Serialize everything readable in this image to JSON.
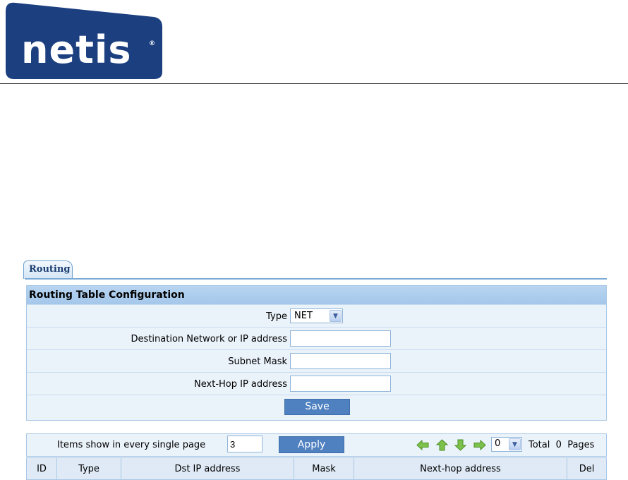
{
  "brand": {
    "logo_text": "netis",
    "registered_mark": "®",
    "color": "#1c3f80"
  },
  "tabs": [
    {
      "label": "Routing",
      "active": true
    }
  ],
  "form": {
    "title": "Routing Table Configuration",
    "type_label": "Type",
    "type_value": "NET",
    "destination_label": "Destination Network or IP address",
    "destination_value": "",
    "subnet_label": "Subnet Mask",
    "subnet_value": "",
    "nexthop_label": "Next-Hop IP address",
    "nexthop_value": "",
    "save_label": "Save"
  },
  "paging": {
    "items_label": "Items show in every single page",
    "items_value": "3",
    "apply_label": "Apply",
    "page_value": "0",
    "total_label": "Total",
    "total_pages": "0",
    "pages_label": "Pages",
    "nav_icons": [
      "first-page-icon",
      "prev-page-icon",
      "next-page-icon",
      "last-page-icon"
    ]
  },
  "table": {
    "columns": [
      "ID",
      "Type",
      "Dst IP address",
      "Mask",
      "Next-hop address",
      "Del"
    ]
  },
  "colors": {
    "accent": "#4f81c1",
    "panel_bg": "#eaf2fa",
    "header_bg": "#a4c7ea",
    "icon_green": "#7cc24a"
  }
}
